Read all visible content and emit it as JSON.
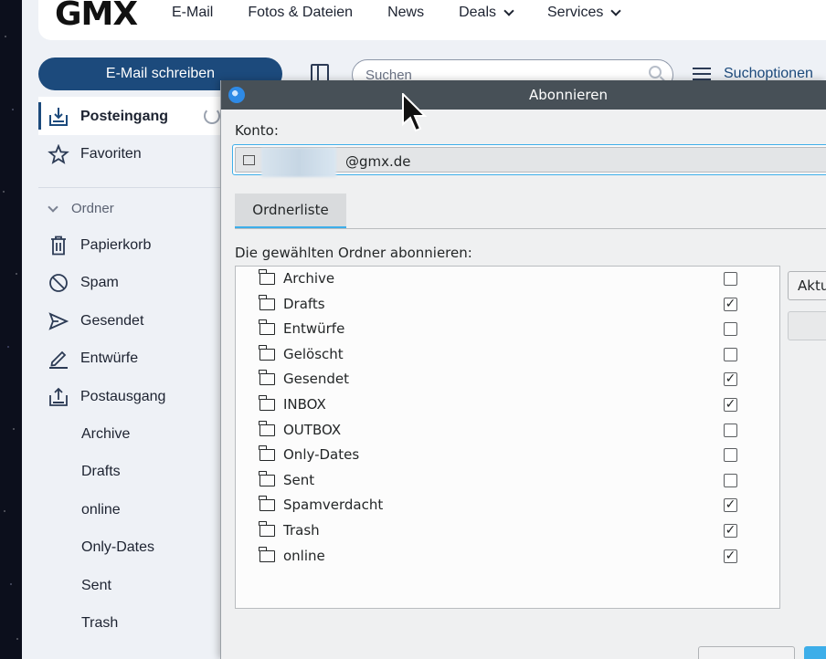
{
  "header": {
    "logo": "GMX",
    "nav": [
      {
        "label": "E-Mail",
        "dropdown": false
      },
      {
        "label": "Fotos & Dateien",
        "dropdown": false
      },
      {
        "label": "News",
        "dropdown": false
      },
      {
        "label": "Deals",
        "dropdown": true
      },
      {
        "label": "Services",
        "dropdown": true
      }
    ]
  },
  "toolbar": {
    "compose_label": "E-Mail schreiben",
    "search_placeholder": "Suchen",
    "search_options_label": "Suchoptionen"
  },
  "sidebar": {
    "inbox_label": "Posteingang",
    "favorites_label": "Favoriten",
    "folders_heading": "Ordner",
    "items": [
      {
        "label": "Papierkorb",
        "icon": "trash-icon"
      },
      {
        "label": "Spam",
        "icon": "spam-icon"
      },
      {
        "label": "Gesendet",
        "icon": "send-icon"
      },
      {
        "label": "Entwürfe",
        "icon": "pencil-icon"
      },
      {
        "label": "Postausgang",
        "icon": "outbox-icon"
      }
    ],
    "subfolders": [
      "Archive",
      "Drafts",
      "online",
      "Only-Dates",
      "Sent",
      "Trash"
    ]
  },
  "dialog": {
    "title": "Abonnieren",
    "account_label": "Konto:",
    "account_value": "@gmx.de",
    "tab_label": "Ordnerliste",
    "subscribe_label": "Die gewählten Ordner abonnieren:",
    "side_button_label": "Aktu",
    "folders": [
      {
        "name": "Archive",
        "checked": false
      },
      {
        "name": "Drafts",
        "checked": true
      },
      {
        "name": "Entwürfe",
        "checked": false
      },
      {
        "name": "Gelöscht",
        "checked": false
      },
      {
        "name": "Gesendet",
        "checked": true
      },
      {
        "name": "INBOX",
        "checked": true
      },
      {
        "name": "OUTBOX",
        "checked": false
      },
      {
        "name": "Only-Dates",
        "checked": false
      },
      {
        "name": "Sent",
        "checked": false
      },
      {
        "name": "Spamverdacht",
        "checked": true
      },
      {
        "name": "Trash",
        "checked": true
      },
      {
        "name": "online",
        "checked": true
      }
    ]
  },
  "colors": {
    "brand_blue": "#1c4a7c",
    "kde_accent": "#3daee9",
    "titlebar": "#475057"
  }
}
